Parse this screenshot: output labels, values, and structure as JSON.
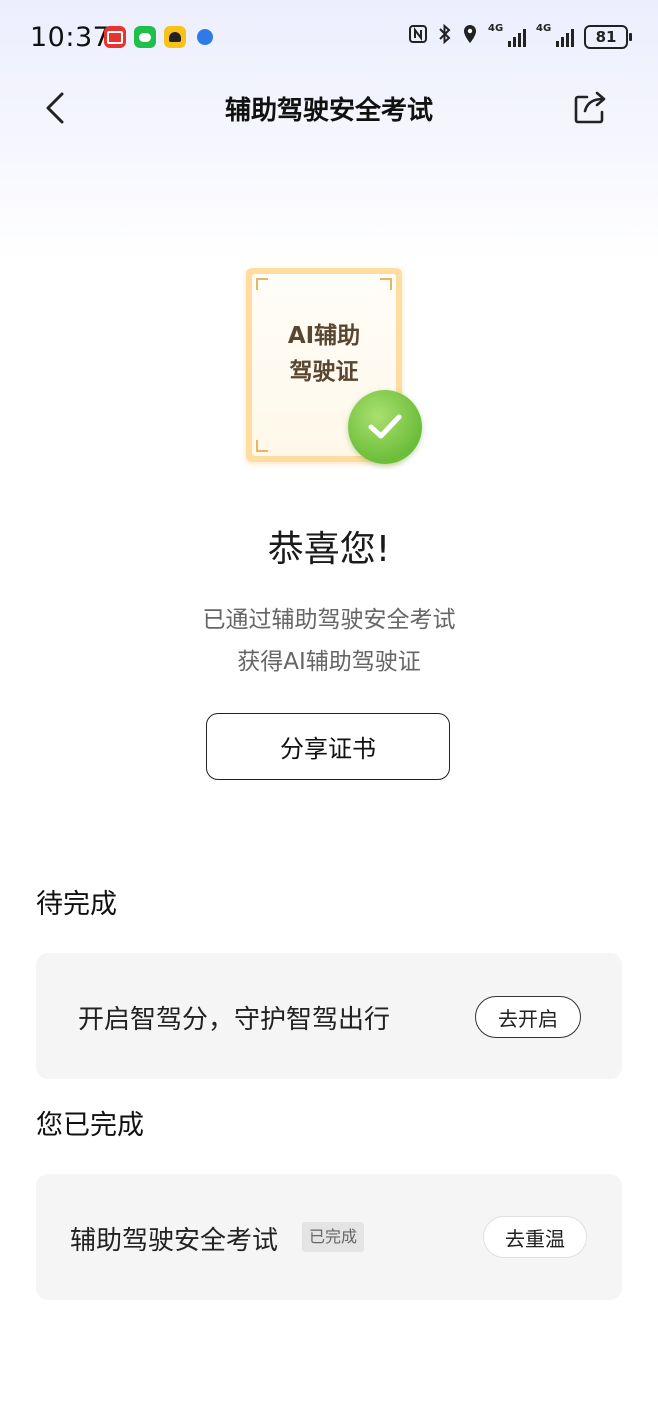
{
  "status_bar": {
    "time": "10:37",
    "apps": [
      "red-app-icon",
      "wechat-icon",
      "yellow-app-icon",
      "browser-icon"
    ],
    "signal1_label": "4G",
    "signal2_label": "4G",
    "battery": "81"
  },
  "header": {
    "title": "辅助驾驶安全考试"
  },
  "certificate": {
    "line1": "AI辅助",
    "line2": "驾驶证",
    "accent_color": "#ffdca0",
    "check_color": "#6cbd3a"
  },
  "result": {
    "title": "恭喜您!",
    "line1": "已通过辅助驾驶安全考试",
    "line2": "获得AI辅助驾驶证",
    "share_button": "分享证书"
  },
  "pending": {
    "section_title": "待完成",
    "item_text": "开启智驾分，守护智驾出行",
    "item_button": "去开启"
  },
  "completed": {
    "section_title": "您已完成",
    "item_text": "辅助驾驶安全考试",
    "item_tag": "已完成",
    "item_button": "去重温"
  }
}
